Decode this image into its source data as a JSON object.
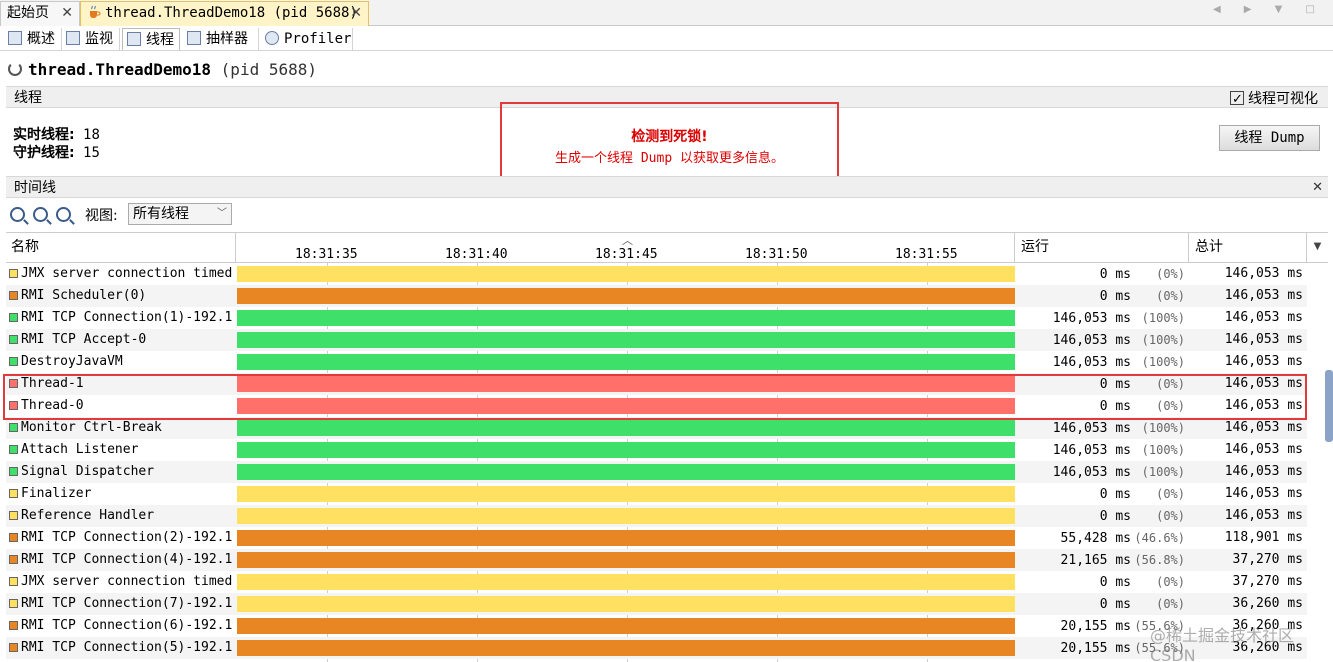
{
  "doc_tabs": [
    {
      "label": "起始页",
      "close": "✕"
    },
    {
      "label": "thread.ThreadDemo18 (pid 5688)",
      "close": "✕"
    }
  ],
  "sub_tabs": [
    "概述",
    "监视",
    "线程",
    "抽样器",
    "Profiler"
  ],
  "process_title": {
    "name": "thread.ThreadDemo18",
    "pid": "(pid 5688)"
  },
  "section_threads": {
    "label": "线程",
    "viz_checkbox": "线程可视化",
    "viz_checked": true
  },
  "stats": {
    "live_label": "实时线程:",
    "live_value": "18",
    "daemon_label": "守护线程:",
    "daemon_value": "15"
  },
  "deadlock": {
    "title": "检测到死锁!",
    "message": "生成一个线程 Dump 以获取更多信息。"
  },
  "dump_button": "线程 Dump",
  "timeline_section": {
    "label": "时间线",
    "close": "✕"
  },
  "toolbar": {
    "view_label": "视图:",
    "view_value": "所有线程"
  },
  "columns": {
    "name": "名称",
    "run": "运行",
    "total": "总计"
  },
  "ticks": [
    "18:31:35",
    "18:31:40",
    "18:31:45",
    "18:31:50",
    "18:31:55"
  ],
  "state_colors": {
    "waiting": "#ffe060",
    "sleeping": "#e88624",
    "running": "#3ee06a",
    "monitor": "#ff706a"
  },
  "rows": [
    {
      "name": "JMX server connection timed",
      "state": "waiting",
      "run": "0 ms",
      "pct": "(0%)",
      "total": "146,053 ms"
    },
    {
      "name": "RMI Scheduler(0)",
      "state": "sleeping",
      "run": "0 ms",
      "pct": "(0%)",
      "total": "146,053 ms"
    },
    {
      "name": "RMI TCP Connection(1)-192.1",
      "state": "running",
      "run": "146,053 ms",
      "pct": "(100%)",
      "total": "146,053 ms"
    },
    {
      "name": "RMI TCP Accept-0",
      "state": "running",
      "run": "146,053 ms",
      "pct": "(100%)",
      "total": "146,053 ms"
    },
    {
      "name": "DestroyJavaVM",
      "state": "running",
      "run": "146,053 ms",
      "pct": "(100%)",
      "total": "146,053 ms"
    },
    {
      "name": "Thread-1",
      "state": "monitor",
      "run": "0 ms",
      "pct": "(0%)",
      "total": "146,053 ms"
    },
    {
      "name": "Thread-0",
      "state": "monitor",
      "run": "0 ms",
      "pct": "(0%)",
      "total": "146,053 ms"
    },
    {
      "name": "Monitor Ctrl-Break",
      "state": "running",
      "run": "146,053 ms",
      "pct": "(100%)",
      "total": "146,053 ms"
    },
    {
      "name": "Attach Listener",
      "state": "running",
      "run": "146,053 ms",
      "pct": "(100%)",
      "total": "146,053 ms"
    },
    {
      "name": "Signal Dispatcher",
      "state": "running",
      "run": "146,053 ms",
      "pct": "(100%)",
      "total": "146,053 ms"
    },
    {
      "name": "Finalizer",
      "state": "waiting",
      "run": "0 ms",
      "pct": "(0%)",
      "total": "146,053 ms"
    },
    {
      "name": "Reference Handler",
      "state": "waiting",
      "run": "0 ms",
      "pct": "(0%)",
      "total": "146,053 ms"
    },
    {
      "name": "RMI TCP Connection(2)-192.1",
      "state": "sleeping",
      "run": "55,428 ms",
      "pct": "(46.6%)",
      "total": "118,901 ms"
    },
    {
      "name": "RMI TCP Connection(4)-192.1",
      "state": "sleeping",
      "run": "21,165 ms",
      "pct": "(56.8%)",
      "total": "37,270 ms"
    },
    {
      "name": "JMX server connection timed",
      "state": "waiting",
      "run": "0 ms",
      "pct": "(0%)",
      "total": "37,270 ms"
    },
    {
      "name": "RMI TCP Connection(7)-192.1",
      "state": "waiting",
      "run": "0 ms",
      "pct": "(0%)",
      "total": "36,260 ms"
    },
    {
      "name": "RMI TCP Connection(6)-192.1",
      "state": "sleeping",
      "run": "20,155 ms",
      "pct": "(55.6%)",
      "total": "36,260 ms"
    },
    {
      "name": "RMI TCP Connection(5)-192.1",
      "state": "sleeping",
      "run": "20,155 ms",
      "pct": "(55.6%)",
      "total": "36,260 ms"
    }
  ],
  "watermark": "@稀土掘金技术社区 CSDN"
}
